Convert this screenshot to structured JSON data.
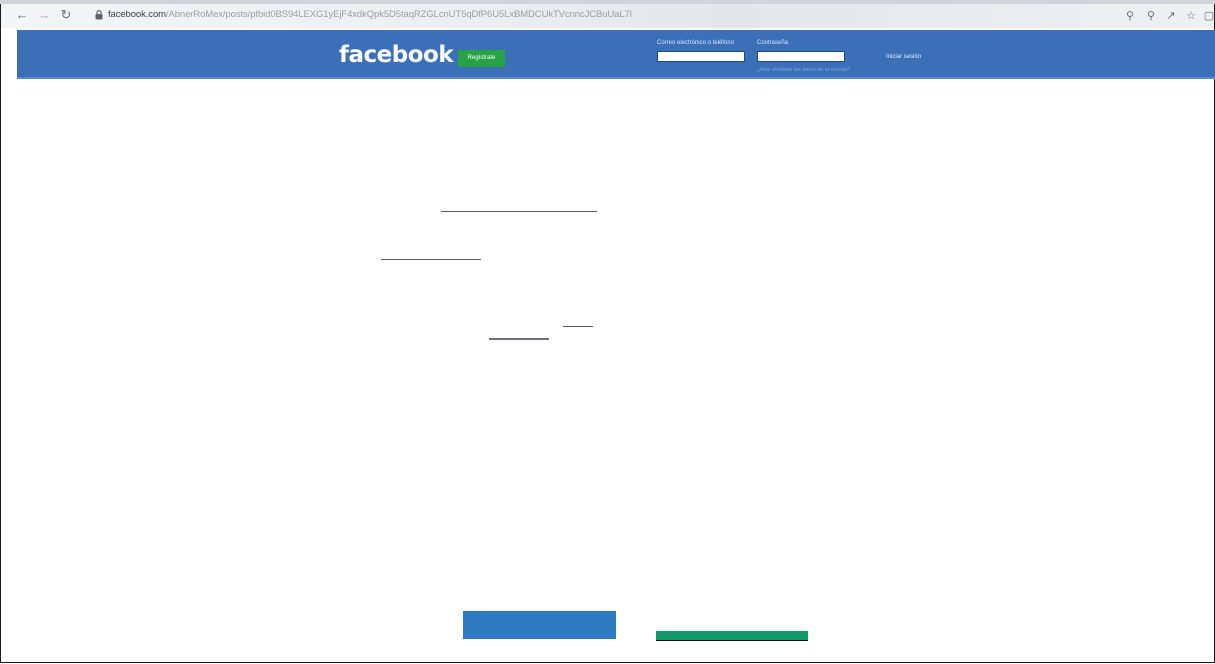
{
  "browser": {
    "url_host": "facebook.com",
    "url_path": "/AbnerRoMex/posts/pfbid0BS94LEXG1yEjF4xdkQpk5D5taqRZGLcnUT5qDfP6U5LxBMDCUkTVcnncJCBuUaL7l",
    "back_icon": "arrow-left-icon",
    "forward_icon": "arrow-right-icon",
    "reload_icon": "reload-icon",
    "lock_icon": "lock-icon",
    "key_icon": "key-icon",
    "zoom_icon": "magnifier-icon",
    "share_icon": "share-icon",
    "star_icon": "star-icon",
    "tab_icon": "tab-icon"
  },
  "facebook_header": {
    "logo": "facebook",
    "register_label": "Regístrate",
    "email_label": "Correo electrónico o teléfono",
    "password_label": "Contraseña",
    "forgot_label": "¿Has olvidado los datos de la cuenta?",
    "login_label": "Iniciar sesión",
    "brand_color": "#3b6fb8",
    "register_color": "#27a244"
  },
  "footer_buttons": {
    "primary_color": "#2f7bc1",
    "secondary_color": "#129a68"
  }
}
